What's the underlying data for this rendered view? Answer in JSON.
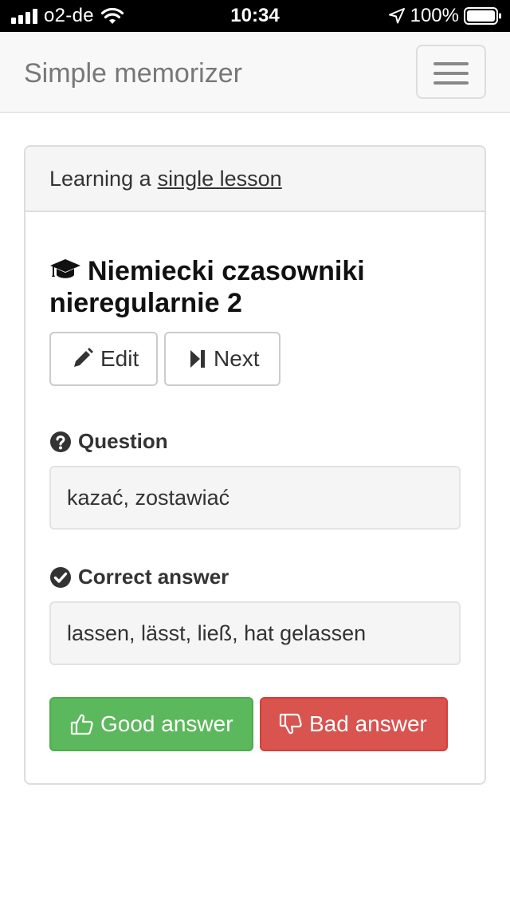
{
  "status_bar": {
    "carrier": "o2-de",
    "time": "10:34",
    "battery": "100%",
    "icons": [
      "signal-icon",
      "wifi-icon",
      "location-icon",
      "battery-icon"
    ]
  },
  "navbar": {
    "brand": "Simple memorizer",
    "menu_icon": "hamburger-menu-icon"
  },
  "panel": {
    "heading_prefix": "Learning a",
    "heading_link": "single lesson",
    "lesson_title": "Niemiecki czasowniki nieregularnie 2",
    "lesson_icon": "graduation-cap-icon",
    "edit_label": "Edit",
    "next_label": "Next",
    "question_label": "Question",
    "question_text": "kazać, zostawiać",
    "answer_label": "Correct answer",
    "answer_text": "lassen, lässt, ließ, hat gelassen",
    "good_label": "Good answer",
    "bad_label": "Bad answer"
  },
  "colors": {
    "success": "#5cb85c",
    "danger": "#d9534f",
    "navbar_bg": "#f8f8f8",
    "panel_heading_bg": "#f5f5f5"
  }
}
